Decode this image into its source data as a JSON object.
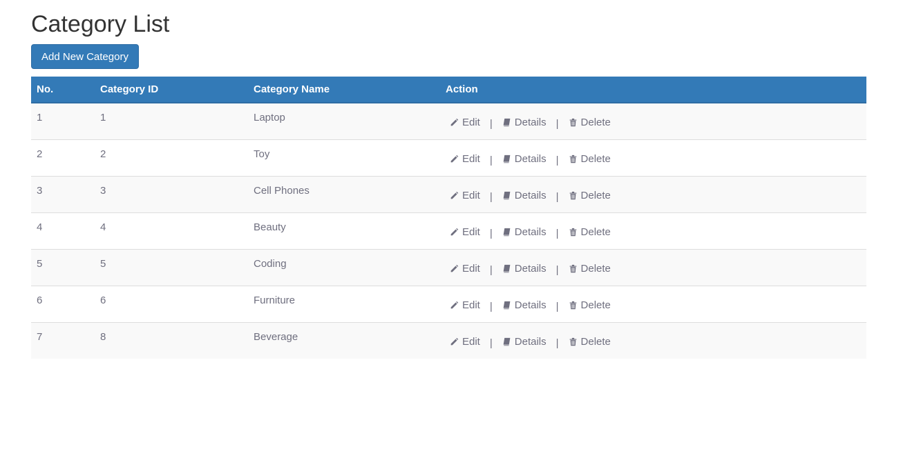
{
  "page": {
    "title": "Category List",
    "add_button_label": "Add New Category"
  },
  "table": {
    "headers": [
      "No.",
      "Category ID",
      "Category Name",
      "Action"
    ],
    "rows": [
      {
        "no": "1",
        "id": "1",
        "name": "Laptop"
      },
      {
        "no": "2",
        "id": "2",
        "name": "Toy"
      },
      {
        "no": "3",
        "id": "3",
        "name": "Cell Phones"
      },
      {
        "no": "4",
        "id": "4",
        "name": "Beauty"
      },
      {
        "no": "5",
        "id": "5",
        "name": "Coding"
      },
      {
        "no": "6",
        "id": "6",
        "name": "Furniture"
      },
      {
        "no": "7",
        "id": "8",
        "name": "Beverage"
      }
    ],
    "actions": {
      "edit": "Edit",
      "details": "Details",
      "delete": "Delete",
      "separator": "|"
    },
    "icons": {
      "edit": "pencil-icon",
      "details": "book-icon",
      "delete": "trash-icon"
    }
  },
  "colors": {
    "primary": "#337ab7",
    "row_text": "#6f6f7f",
    "stripe": "#f9f9f9"
  }
}
